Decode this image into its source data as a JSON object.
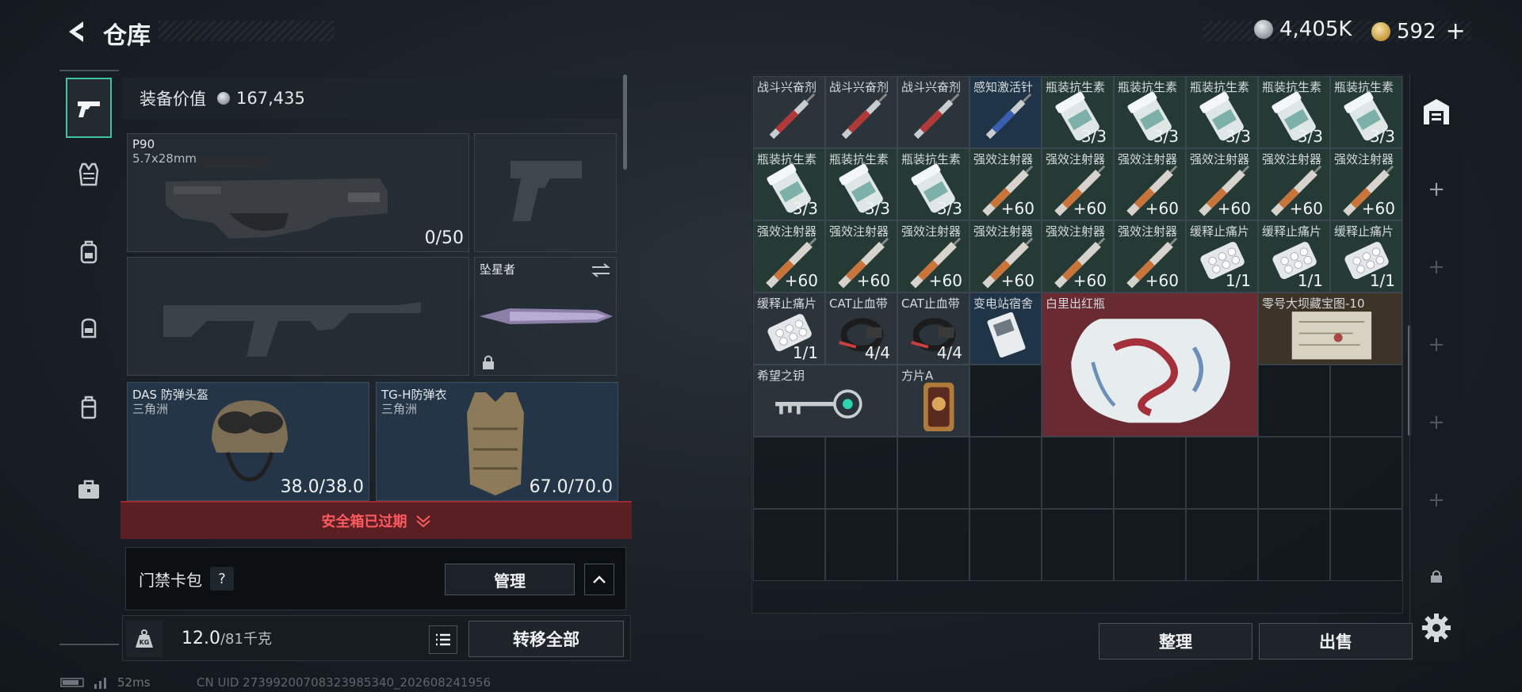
{
  "header": {
    "title": "仓库",
    "currency_silver": "4,405K",
    "currency_gold": "592"
  },
  "equip": {
    "value_label": "装备价值",
    "value": "167,435",
    "primary": {
      "name": "P90",
      "ammo_type": "5.7x28mm",
      "ammo": "0/50"
    },
    "melee": {
      "name": "坠星者"
    },
    "helmet": {
      "name": "DAS 防弹头盔",
      "source": "三角洲",
      "durability": "38.0/38.0"
    },
    "armor": {
      "name": "TG-H防弹衣",
      "source": "三角洲",
      "durability": "67.0/70.0"
    }
  },
  "safe_box": {
    "expired_label": "安全箱已过期"
  },
  "card_pack": {
    "label": "门禁卡包",
    "help": "?",
    "manage_label": "管理"
  },
  "weight": {
    "current": "12.0",
    "max": "/81千克",
    "kg_icon": "KG",
    "transfer_label": "转移全部"
  },
  "status": {
    "ping": "52ms",
    "uid": "CN UID 27399200708323985340_202608241956"
  },
  "grid": {
    "items": [
      {
        "name": "战斗兴奋剂",
        "count": "",
        "color": "gray",
        "icon": "syringe-red-icon"
      },
      {
        "name": "战斗兴奋剂",
        "count": "",
        "color": "gray",
        "icon": "syringe-red-icon"
      },
      {
        "name": "战斗兴奋剂",
        "count": "",
        "color": "gray",
        "icon": "syringe-red-icon"
      },
      {
        "name": "感知激活针",
        "count": "",
        "color": "blue",
        "icon": "syringe-blue-icon"
      },
      {
        "name": "瓶装抗生素",
        "count": "3/3",
        "color": "green",
        "icon": "pill-bottle-icon"
      },
      {
        "name": "瓶装抗生素",
        "count": "3/3",
        "color": "green",
        "icon": "pill-bottle-icon"
      },
      {
        "name": "瓶装抗生素",
        "count": "3/3",
        "color": "green",
        "icon": "pill-bottle-icon"
      },
      {
        "name": "瓶装抗生素",
        "count": "3/3",
        "color": "green",
        "icon": "pill-bottle-icon"
      },
      {
        "name": "瓶装抗生素",
        "count": "3/3",
        "color": "green",
        "icon": "pill-bottle-icon"
      },
      {
        "name": "瓶装抗生素",
        "count": "3/3",
        "color": "green",
        "icon": "pill-bottle-icon"
      },
      {
        "name": "瓶装抗生素",
        "count": "3/3",
        "color": "green",
        "icon": "pill-bottle-icon"
      },
      {
        "name": "瓶装抗生素",
        "count": "3/3",
        "color": "green",
        "icon": "pill-bottle-icon"
      },
      {
        "name": "强效注射器",
        "count": "+60",
        "color": "green",
        "icon": "injector-icon"
      },
      {
        "name": "强效注射器",
        "count": "+60",
        "color": "green",
        "icon": "injector-icon"
      },
      {
        "name": "强效注射器",
        "count": "+60",
        "color": "green",
        "icon": "injector-icon"
      },
      {
        "name": "强效注射器",
        "count": "+60",
        "color": "green",
        "icon": "injector-icon"
      },
      {
        "name": "强效注射器",
        "count": "+60",
        "color": "green",
        "icon": "injector-icon"
      },
      {
        "name": "强效注射器",
        "count": "+60",
        "color": "green",
        "icon": "injector-icon"
      },
      {
        "name": "强效注射器",
        "count": "+60",
        "color": "green",
        "icon": "injector-icon"
      },
      {
        "name": "强效注射器",
        "count": "+60",
        "color": "green",
        "icon": "injector-icon"
      },
      {
        "name": "强效注射器",
        "count": "+60",
        "color": "green",
        "icon": "injector-icon"
      },
      {
        "name": "强效注射器",
        "count": "+60",
        "color": "green",
        "icon": "injector-icon"
      },
      {
        "name": "强效注射器",
        "count": "+60",
        "color": "green",
        "icon": "injector-icon"
      },
      {
        "name": "强效注射器",
        "count": "+60",
        "color": "green",
        "icon": "injector-icon"
      },
      {
        "name": "缓释止痛片",
        "count": "1/1",
        "color": "green",
        "icon": "pill-pack-icon"
      },
      {
        "name": "缓释止痛片",
        "count": "1/1",
        "color": "green",
        "icon": "pill-pack-icon"
      },
      {
        "name": "缓释止痛片",
        "count": "1/1",
        "color": "green",
        "icon": "pill-pack-icon"
      },
      {
        "name": "缓释止痛片",
        "count": "1/1",
        "color": "gray",
        "icon": "pill-pack-icon"
      },
      {
        "name": "CAT止血带",
        "count": "4/4",
        "color": "gray",
        "icon": "tourniquet-icon"
      },
      {
        "name": "CAT止血带",
        "count": "4/4",
        "color": "gray",
        "icon": "tourniquet-icon"
      },
      {
        "name": "变电站宿舍",
        "count": "",
        "color": "blue",
        "icon": "keycard-icon"
      },
      {
        "name": "白里出红瓶",
        "count": "",
        "color": "red",
        "icon": "vase-icon"
      },
      {
        "name": "零号大坝藏宝图-10",
        "count": "",
        "color": "gold",
        "icon": "map-icon"
      },
      {
        "name": "希望之钥",
        "count": "",
        "color": "gray",
        "icon": "key-icon"
      },
      {
        "name": "方片A",
        "count": "",
        "color": "gray",
        "icon": "card-icon"
      }
    ]
  },
  "actions": {
    "tidy_label": "整理",
    "sell_label": "出售"
  }
}
